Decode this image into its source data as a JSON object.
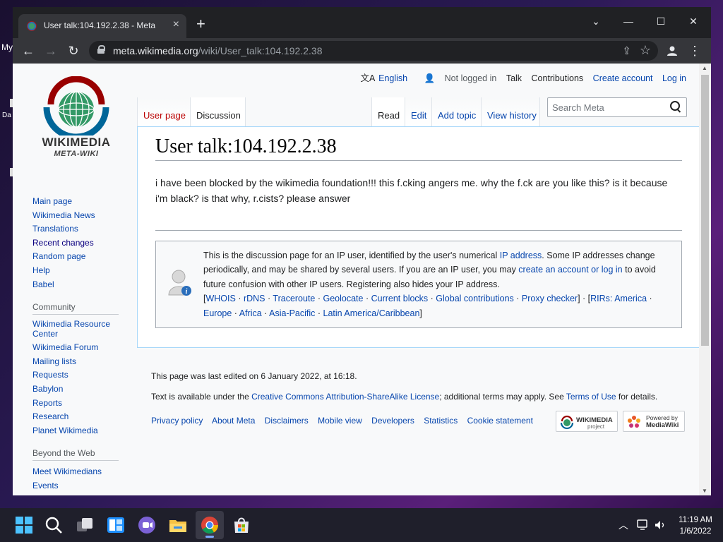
{
  "desktop": {
    "label_1": "My",
    "label_2": "Da"
  },
  "browser": {
    "tab_title": "User talk:104.192.2.38 - Meta",
    "tab_close": "×",
    "new_tab": "+",
    "url_host": "meta.wikimedia.org",
    "url_path": "/wiki/User_talk:104.192.2.38",
    "window_controls": {
      "minimize": "—",
      "maximize": "☐",
      "close": "✕",
      "tabsearch": "⌄"
    },
    "nav": {
      "back": "←",
      "forward": "→",
      "reload": "↻"
    }
  },
  "wiki": {
    "personal": {
      "language": "English",
      "not_logged_in": "Not logged in",
      "talk": "Talk",
      "contributions": "Contributions",
      "create_account": "Create account",
      "log_in": "Log in"
    },
    "logo": {
      "name": "WIKIMEDIA",
      "sub": "META-WIKI"
    },
    "tabs_left": [
      "User page",
      "Discussion"
    ],
    "tabs_right": [
      "Read",
      "Edit",
      "Add topic",
      "View history"
    ],
    "search_placeholder": "Search Meta",
    "sidebar": {
      "nav": [
        "Main page",
        "Wikimedia News",
        "Translations",
        "Recent changes",
        "Random page",
        "Help",
        "Babel"
      ],
      "community_heading": "Community",
      "community": [
        "Wikimedia Resource Center",
        "Wikimedia Forum",
        "Mailing lists",
        "Requests",
        "Babylon",
        "Reports",
        "Research",
        "Planet Wikimedia"
      ],
      "beyond_heading": "Beyond the Web",
      "beyond": [
        "Meet Wikimedians",
        "Events"
      ]
    },
    "title": "User talk:104.192.2.38",
    "body_line_1": "i have been blocked by the wikimedia foundation!!! this f.cking angers me. why the f.ck are you like this? is it because",
    "body_line_2": "i'm black? is that why, r.cists? please answer",
    "notice": {
      "p1_a": "This is the discussion page for an IP user, identified by the user's numerical ",
      "p1_link": "IP address",
      "p1_b": ". Some IP addresses change periodically, and may be shared by several users. If you are an IP user, you may ",
      "p1_link2": "create an account or log in",
      "p1_c": " to avoid future confusion with other IP users. Registering also hides your IP address.",
      "tools": [
        "WHOIS",
        "rDNS",
        "Traceroute",
        "Geolocate",
        "Current blocks",
        "Global contributions",
        "Proxy checker"
      ],
      "rirs": [
        "RIRs: America",
        "Europe",
        "Africa",
        "Asia-Pacific",
        "Latin America/Caribbean"
      ]
    },
    "footer": {
      "last_edited": "This page was last edited on 6 January 2022, at 16:18.",
      "license_a": "Text is available under the ",
      "license_link": "Creative Commons Attribution-ShareAlike License",
      "license_b": "; additional terms may apply. See ",
      "terms_link": "Terms of Use",
      "license_c": " for details.",
      "links": [
        "Privacy policy",
        "About Meta",
        "Disclaimers",
        "Mobile view",
        "Developers",
        "Statistics",
        "Cookie statement"
      ],
      "badge_wikimedia": "WIKIMEDIA",
      "badge_wikimedia_sub": "project",
      "badge_mediawiki_top": "Powered by",
      "badge_mediawiki": "MediaWiki"
    }
  },
  "taskbar": {
    "time": "11:19 AM",
    "date": "1/6/2022"
  },
  "colors": {
    "link": "#0645ad",
    "chrome_dark": "#202124",
    "chrome_toolbar": "#35363a"
  }
}
